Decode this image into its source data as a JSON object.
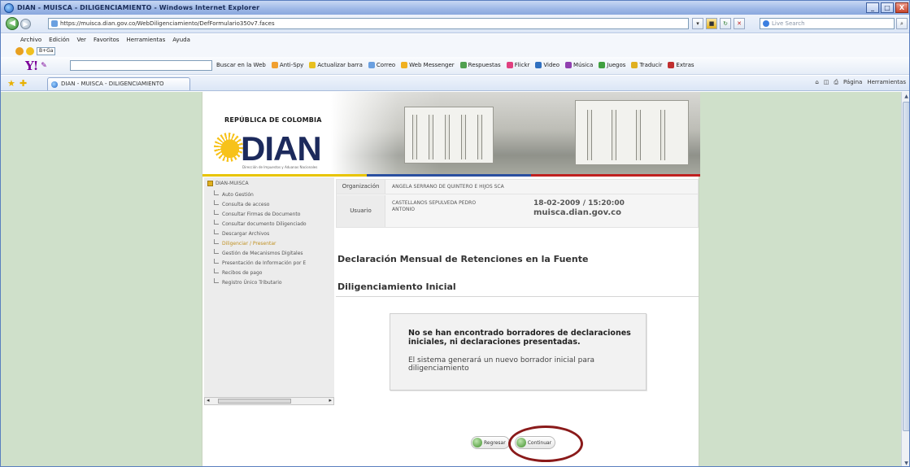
{
  "window": {
    "title": "DIAN - MUISCA - DILIGENCIAMIENTO - Windows Internet Explorer",
    "buttons": [
      "_",
      "□",
      "X"
    ]
  },
  "address_bar": {
    "url": "https://muisca.dian.gov.co/WebDiligenciamiento/DefFormulario350v7.faces",
    "search_placeholder": "Live Search"
  },
  "menu": [
    "Archivo",
    "Edición",
    "Ver",
    "Favoritos",
    "Herramientas",
    "Ayuda"
  ],
  "toolbar": {
    "select_value": "B+Ga",
    "yahoo_logo": "Y!",
    "items": [
      "Buscar en la Web",
      "Anti-Spy",
      "Actualizar barra",
      "Correo",
      "Web Messenger",
      "Respuestas",
      "Flickr",
      "Video",
      "Música",
      "Juegos",
      "Traducir",
      "Extras"
    ]
  },
  "tabs": {
    "active": "DIAN - MUISCA - DILIGENCIAMIENTO",
    "commands": [
      "Página",
      "Herramientas"
    ]
  },
  "header": {
    "country": "REPÚBLICA DE COLOMBIA",
    "logo": "DIAN",
    "logo_sub": "Dirección de Impuestos y Aduanas Nacionales"
  },
  "nav": {
    "root": "DIAN-MUISCA",
    "items": [
      "Auto Gestión",
      "Consulta de acceso",
      "Consultar Firmas de Documento",
      "Consultar documento Diligenciado",
      "Descargar Archivos",
      "Diligenciar / Presentar",
      "Gestión de Mecanismos Digitales",
      "Presentación de Información por E",
      "Recibos de pago",
      "Registro Único Tributario"
    ],
    "selected_index": 5
  },
  "info": {
    "org_label": "Organización",
    "org_value": "ANGELA SERRANO DE QUINTERO E HIJOS SCA",
    "user_label": "Usuario",
    "user_value": "CASTELLANOS SEPULVEDA PEDRO ANTONIO",
    "datetime": "18-02-2009 / 15:20:00",
    "site": "muisca.dian.gov.co"
  },
  "main": {
    "title": "Declaración Mensual de Retenciones en la Fuente",
    "subtitle": "Diligenciamiento Inicial",
    "message_bold": "No se han encontrado borradores de declaraciones iniciales, ni declaraciones presentadas.",
    "message": "El sistema generará un nuevo borrador inicial para diligenciamiento",
    "back_button": "Regresar",
    "continue_button": "Continuar"
  }
}
